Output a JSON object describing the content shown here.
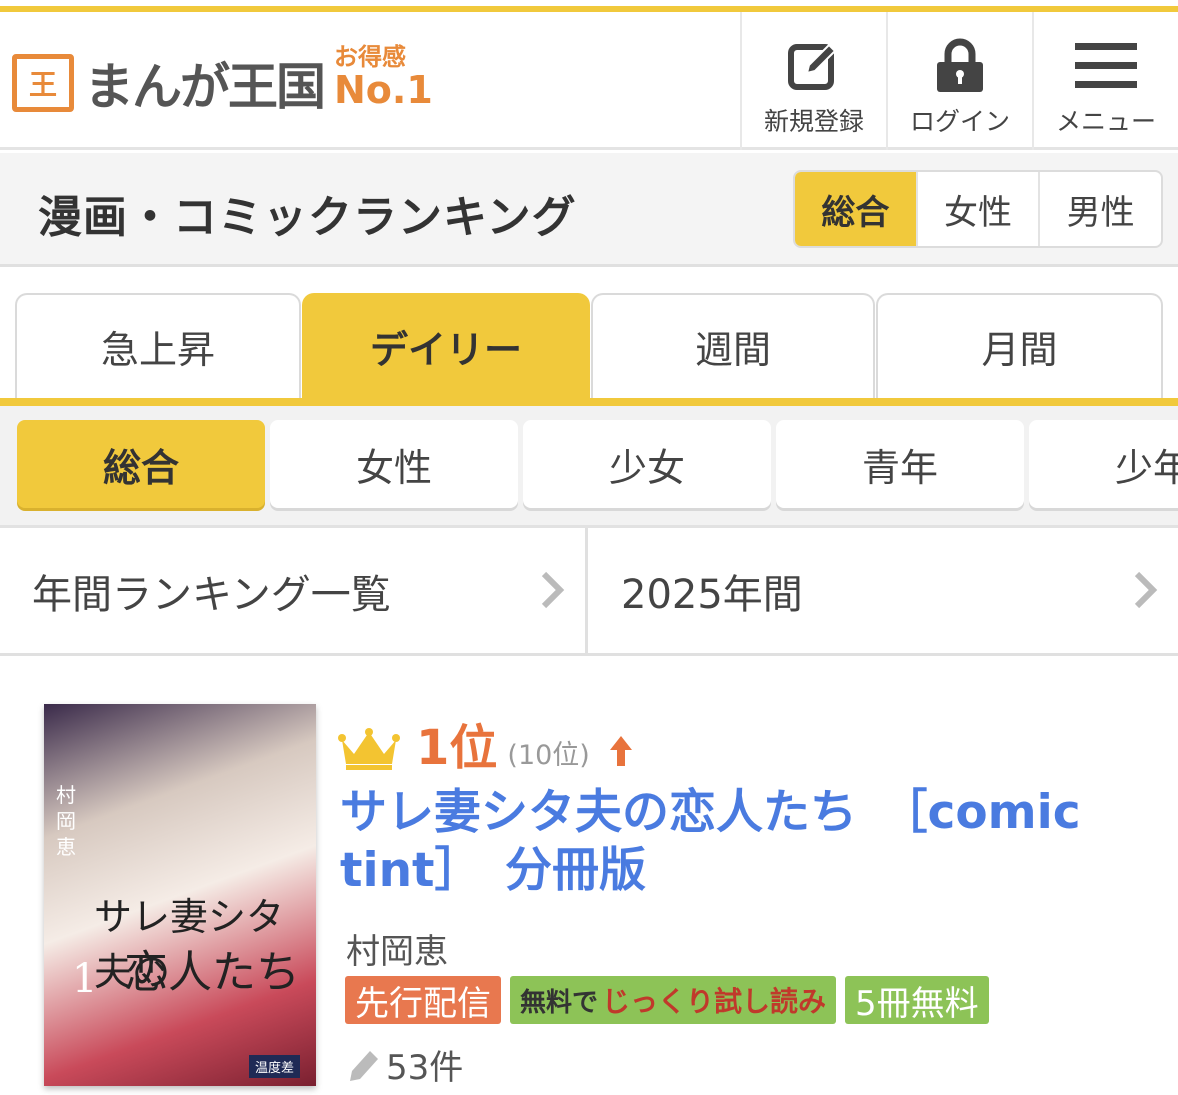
{
  "header": {
    "logo_mark": "王",
    "logo_text": "まんが王国",
    "badge_small": "お得感",
    "badge_big": "No.1",
    "buttons": {
      "register": "新規登録",
      "login": "ログイン",
      "menu": "メニュー"
    }
  },
  "titlebar": {
    "title": "漫画・コミックランキング",
    "segments": [
      "総合",
      "女性",
      "男性"
    ]
  },
  "period_tabs": [
    "急上昇",
    "デイリー",
    "週間",
    "月間"
  ],
  "genres": [
    "総合",
    "女性",
    "少女",
    "青年",
    "少年"
  ],
  "year_row": {
    "list_label": "年間ランキング一覧",
    "year_label": "2025年間"
  },
  "item": {
    "rank": "1位",
    "prev_rank": "(10位)",
    "title": "サレ妻シタ夫の恋人たち　［comic tint］　分冊版",
    "author": "村岡恵",
    "tags": {
      "pre": "先行配信",
      "trial_prefix": "無料で",
      "trial": "じっくり試し読み",
      "free": "5冊無料"
    },
    "reviews": "53件",
    "cover": {
      "vertical": "村岡恵",
      "title1": "サレ妻シタ夫の",
      "title2": "恋人たち",
      "volume": "1",
      "publisher": "温度差"
    }
  },
  "colors": {
    "accent": "#f1c93c",
    "rank": "#e8733c",
    "link": "#4a7be0",
    "tag_pre": "#e8784f",
    "tag_green": "#8dc357",
    "logo": "#e88a3a"
  },
  "icons": {
    "register": "pencil-edit-icon",
    "login": "lock-icon",
    "menu": "hamburger-icon",
    "crown": "crown-icon",
    "up": "arrow-up-icon",
    "review": "pencil-icon",
    "chevron": "chevron-right-icon"
  }
}
